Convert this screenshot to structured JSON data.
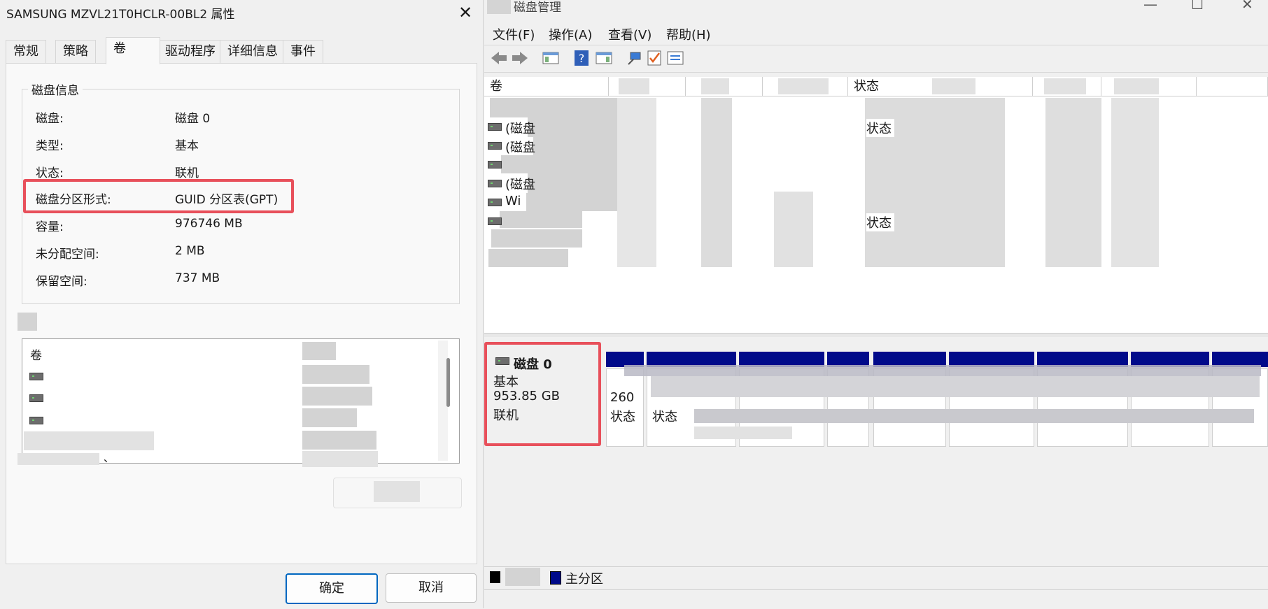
{
  "dialog": {
    "title": "SAMSUNG MZVL21T0HCLR-00BL2 属性",
    "close_glyph": "✕",
    "tabs": [
      "常规",
      "策略",
      "卷",
      "驱动程序",
      "详细信息",
      "事件"
    ],
    "active_tab": "卷",
    "disk_info": {
      "legend": "磁盘信息",
      "rows": [
        {
          "label": "磁盘:",
          "value": "磁盘 0"
        },
        {
          "label": "类型:",
          "value": "基本"
        },
        {
          "label": "状态:",
          "value": "联机"
        },
        {
          "label": "磁盘分区形式:",
          "value": "GUID 分区表(GPT)"
        },
        {
          "label": "容量:",
          "value": "976746 MB"
        },
        {
          "label": "未分配空间:",
          "value": "2 MB"
        },
        {
          "label": "保留空间:",
          "value": "737 MB"
        }
      ]
    },
    "volume_list": {
      "header": "卷",
      "trailing_mark": "、"
    },
    "ok_label": "确定",
    "cancel_label": "取消",
    "highlight_color": "#e8505b"
  },
  "window": {
    "title": "磁盘管理",
    "menus": [
      "文件(F)",
      "操作(A)",
      "查看(V)",
      "帮助(H)"
    ],
    "controls": {
      "minimize": "—",
      "maximize": "☐",
      "close": "✕"
    },
    "columns": {
      "volume": "卷",
      "status": "状态"
    },
    "rows": [
      {
        "text": "(磁盘",
        "status": "状态"
      },
      {
        "text": "(磁盘",
        "status": ""
      },
      {
        "text": "(磁盘",
        "status": ""
      },
      {
        "text": "Wi",
        "status": ""
      },
      {
        "text": "",
        "status": "状态"
      }
    ],
    "disk": {
      "name": "磁盘 0",
      "type": "基本",
      "size": "953.85 GB",
      "state": "联机",
      "first_partition_size": "260",
      "first_partition_status": "状态",
      "second_partition_status": "状态"
    },
    "legend": {
      "primary_label": "主分区",
      "primary_color": "#000a8a",
      "unallocated_color": "#000000"
    }
  }
}
